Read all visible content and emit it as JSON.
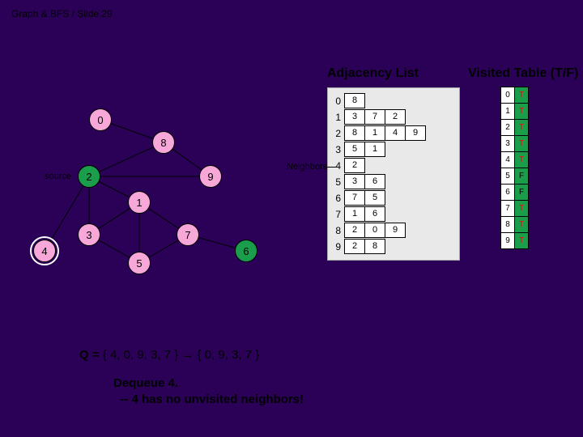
{
  "header": "Graph & BFS / Slide 29",
  "titles": {
    "adj": "Adjacency List",
    "vt": "Visited Table (T/F)"
  },
  "adjacency": [
    {
      "i": 0,
      "n": [
        8
      ]
    },
    {
      "i": 1,
      "n": [
        3,
        7,
        2
      ]
    },
    {
      "i": 2,
      "n": [
        8,
        1,
        4,
        9
      ]
    },
    {
      "i": 3,
      "n": [
        5,
        1
      ]
    },
    {
      "i": 4,
      "n": [
        2
      ]
    },
    {
      "i": 5,
      "n": [
        3,
        6
      ]
    },
    {
      "i": 6,
      "n": [
        7,
        5
      ]
    },
    {
      "i": 7,
      "n": [
        1,
        6
      ]
    },
    {
      "i": 8,
      "n": [
        2,
        0,
        9
      ]
    },
    {
      "i": 9,
      "n": [
        2,
        8
      ]
    }
  ],
  "visited": [
    {
      "i": 0,
      "v": "T"
    },
    {
      "i": 1,
      "v": "T"
    },
    {
      "i": 2,
      "v": "T"
    },
    {
      "i": 3,
      "v": "T"
    },
    {
      "i": 4,
      "v": "T"
    },
    {
      "i": 5,
      "v": "F"
    },
    {
      "i": 6,
      "v": "F"
    },
    {
      "i": 7,
      "v": "T"
    },
    {
      "i": 8,
      "v": "T"
    },
    {
      "i": 9,
      "v": "T"
    }
  ],
  "neighbors_label": "Neighbors",
  "source_label": "source",
  "nodes": {
    "n0": "0",
    "n1": "1",
    "n2": "2",
    "n3": "3",
    "n4": "4",
    "n5": "5",
    "n6": "6",
    "n7": "7",
    "n8": "8",
    "n9": "9"
  },
  "queue": {
    "label": "Q =",
    "text": "{ 4, 0, 9, 3, 7 } → { 0, 9, 3, 7 }"
  },
  "message": {
    "l1": "Dequeue 4.",
    "l2": "  -- 4 has no unvisited neighbors!"
  }
}
